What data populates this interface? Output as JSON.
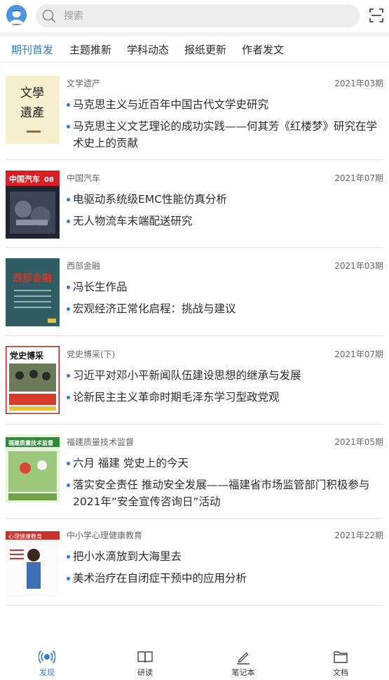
{
  "search": {
    "placeholder": "搜索"
  },
  "tabs": [
    {
      "label": "期刊首发",
      "active": true
    },
    {
      "label": "主题推新"
    },
    {
      "label": "学科动态"
    },
    {
      "label": "报纸更新"
    },
    {
      "label": "作者发文"
    }
  ],
  "items": [
    {
      "journal": "文学遗产",
      "date": "2021年03期",
      "cover_title": "文學遺產",
      "articles": [
        "马克思主义与近百年中国古代文学史研究",
        "马克思主义文艺理论的成功实践——何其芳《红楼梦》研究在学术史上的贡献"
      ]
    },
    {
      "journal": "中国汽车",
      "date": "2021年07期",
      "cover_title": "中国汽车 08",
      "articles": [
        "电驱动系统级EMC性能仿真分析",
        "无人物流车末端配送研究"
      ]
    },
    {
      "journal": "西部金融",
      "date": "2021年03期",
      "cover_title": "西部金融",
      "articles": [
        "冯长生作品",
        "宏观经济正常化启程：挑战与建议"
      ]
    },
    {
      "journal": "党史博采(下)",
      "date": "2021年07期",
      "cover_title": "党史博采",
      "articles": [
        "习近平对邓小平新闻队伍建设思想的继承与发展",
        "论新民主主义革命时期毛泽东学习型政党观"
      ]
    },
    {
      "journal": "福建质量技术监督",
      "date": "2021年05期",
      "cover_title": "福建质量技术监督",
      "articles": [
        "六月 福建  党史上的今天",
        "落实安全责任  推动安全发展——福建省市场监管部门积极参与2021年“安全宣传咨询日”活动"
      ]
    },
    {
      "journal": "中小学心理健康教育",
      "date": "2021年22期",
      "cover_title": "心理健康教育",
      "articles": [
        "把小水滴放到大海里去",
        "美术治疗在自闭症干预中的应用分析"
      ]
    }
  ],
  "bottom_nav": [
    {
      "label": "发现",
      "icon": "radio-waves-icon",
      "active": true
    },
    {
      "label": "研读",
      "icon": "book-icon"
    },
    {
      "label": "笔记本",
      "icon": "pen-icon"
    },
    {
      "label": "文档",
      "icon": "folder-icon"
    }
  ],
  "colors": {
    "accent": "#2b7be0",
    "text": "#2b2b2b",
    "muted": "#666666"
  }
}
